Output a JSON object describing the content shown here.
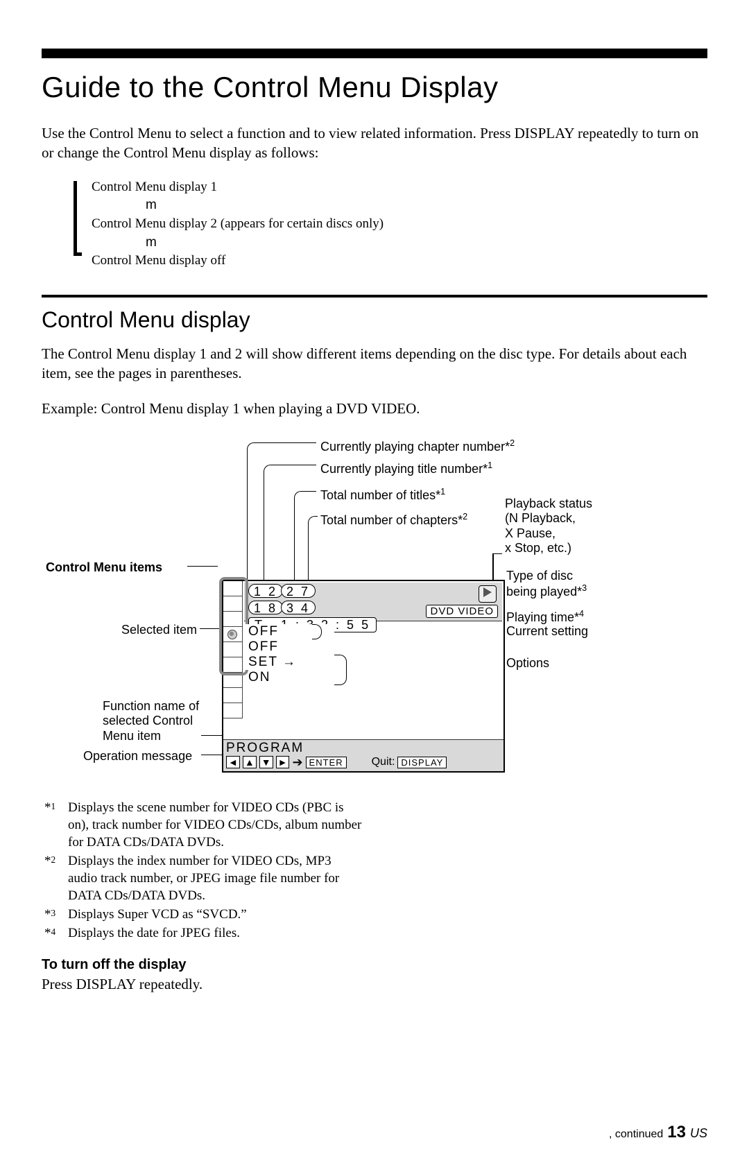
{
  "title": "Guide to the Control Menu Display",
  "intro": "Use the Control Menu to select a function and to view related information. Press DISPLAY repeatedly to turn on or change the Control Menu display as follows:",
  "seq": {
    "line1": "Control Menu display 1",
    "m": "m",
    "line2": "Control Menu display 2 (appears for certain discs only)",
    "line3": "Control Menu display off"
  },
  "h2": "Control Menu display",
  "p2": "The Control Menu display 1 and 2 will show different items depending on the disc type. For details about each item, see the pages in parentheses.",
  "example": "Example: Control Menu display 1 when playing a DVD VIDEO.",
  "labels": {
    "chapter": "Currently playing chapter number*",
    "chapter_sup": "2",
    "titleNum": "Currently playing title number*",
    "titleNum_sup": "1",
    "totalTitles": "Total number of titles*",
    "totalTitles_sup": "1",
    "totalChapters": "Total number of chapters*",
    "totalChapters_sup": "2",
    "playbackStatus1": "Playback status",
    "playbackStatus2": "(N   Playback,",
    "playbackStatus3": "X  Pause,",
    "playbackStatus4": "x   Stop, etc.)",
    "cmi": "Control Menu items",
    "discType1": "Type of disc",
    "discType2": "being played*",
    "discType_sup": "3",
    "selected": "Selected item",
    "playTime": "Playing time*",
    "playTime_sup": "4",
    "curSetting": "Current setting",
    "options": "Options",
    "func1": "Function name of",
    "func2": "selected Control",
    "func3": "Menu item",
    "opmsg": "Operation message"
  },
  "panel": {
    "n12": "1 2",
    "n27": "2 7",
    "n18": "1 8",
    "n34": "3 4",
    "T": "T",
    "time": "1 : 3 2 : 5 5",
    "dvd": "DVD VIDEO",
    "off": "OFF",
    "set": "SET",
    "on": "ON",
    "program": "PROGRAM",
    "enter": "ENTER",
    "quit": "Quit:",
    "display": "DISPLAY"
  },
  "footnotes": {
    "f1": "Displays the scene number for VIDEO CDs (PBC is on), track number for VIDEO CDs/CDs, album number for DATA CDs/DATA DVDs.",
    "f2": "Displays the index number for VIDEO CDs, MP3 audio track number, or JPEG image file number for DATA CDs/DATA DVDs.",
    "f3": "Displays Super VCD as “SVCD.”",
    "f4": "Displays the date for JPEG files."
  },
  "turnOffH": "To turn off the display",
  "turnOffP": "Press DISPLAY repeatedly.",
  "footer": {
    "cont": ",   continued",
    "page": "13",
    "us": "US"
  }
}
